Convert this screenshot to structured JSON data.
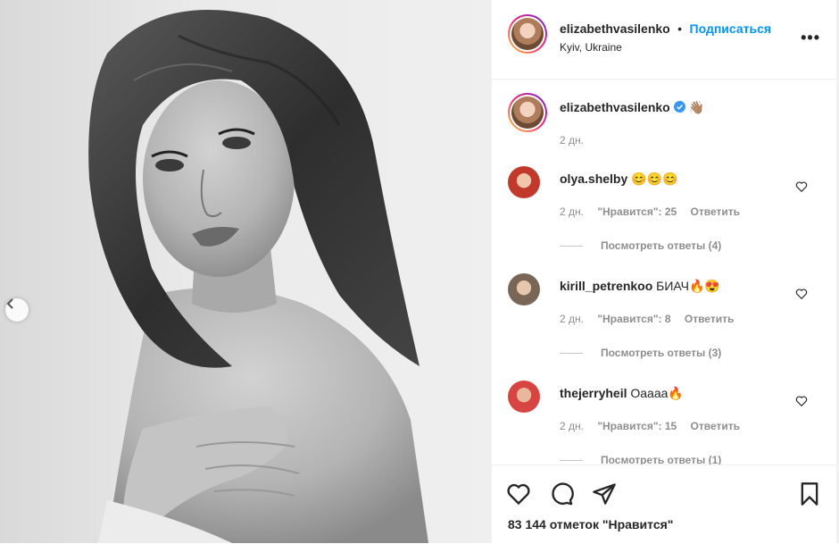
{
  "header": {
    "username": "elizabethvasilenko",
    "separator": "•",
    "follow_label": "Подписаться",
    "location": "Kyiv, Ukraine",
    "more_label": "•••"
  },
  "caption": {
    "username": "elizabethvasilenko",
    "verified": true,
    "emoji": "👋🏽",
    "time": "2 дн."
  },
  "comments": [
    {
      "username": "olya.shelby",
      "text": "😊😊😊",
      "time": "2 дн.",
      "likes": "\"Нравится\": 25",
      "reply": "Ответить",
      "view_replies": "Посмотреть ответы (4)",
      "avatar_color": "#c0392b"
    },
    {
      "username": "kirill_petrenkoo",
      "text": "БИАЧ🔥😍",
      "time": "2 дн.",
      "likes": "\"Нравится\": 8",
      "reply": "Ответить",
      "view_replies": "Посмотреть ответы (3)",
      "avatar_color": "#a08b7a"
    },
    {
      "username": "thejerryheil",
      "text": "Оаааа🔥",
      "time": "2 дн.",
      "likes": "\"Нравится\": 15",
      "reply": "Ответить",
      "view_replies": "Посмотреть ответы (1)",
      "avatar_color": "#d64541"
    }
  ],
  "actions": {
    "likes_text": "83 144 отметок \"Нравится\"",
    "icons": [
      "heart-icon",
      "comment-icon",
      "share-icon",
      "bookmark-icon"
    ]
  },
  "colors": {
    "accent": "#0095f6",
    "verified": "#3897f0",
    "muted": "#8e8e8e"
  }
}
